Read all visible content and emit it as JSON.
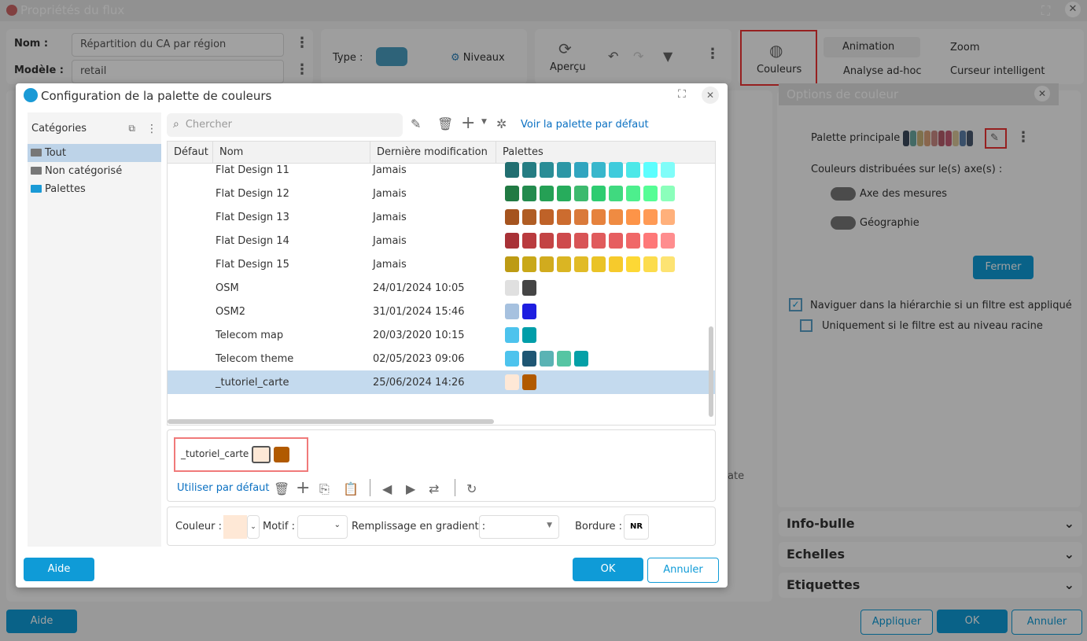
{
  "window": {
    "title": "Propriétés du flux"
  },
  "props": {
    "nom_label": "Nom :",
    "nom_value": "Répartition du CA par région",
    "modele_label": "Modèle :",
    "modele_value": "retail",
    "type_label": "Type :",
    "niveaux": "Niveaux",
    "apercu": "Aperçu",
    "couleurs": "Couleurs",
    "animation": "Animation",
    "zoom": "Zoom",
    "analyse": "Analyse ad-hoc",
    "curseur": "Curseur intelligent",
    "partial_label": "ate"
  },
  "color_options": {
    "title": "Options de couleur",
    "palette_label": "Palette principale :",
    "palette_colors": [
      "#3b4a5c",
      "#6aa9a0",
      "#c9b47a",
      "#d9a27a",
      "#c98a84",
      "#b55c6a",
      "#c35d74",
      "#d9c79a",
      "#5d7fa8",
      "#4a5a70"
    ],
    "axes_label": "Couleurs distribuées sur le(s) axe(s) :",
    "toggle_mesures": "Axe des mesures",
    "toggle_geo": "Géographie",
    "fermer": "Fermer"
  },
  "checks": {
    "naviguer": "Naviguer dans la hiérarchie si un filtre est appliqué",
    "naviguer_checked": true,
    "racine": "Uniquement si le filtre est au niveau racine",
    "racine_checked": false
  },
  "sections": [
    "Info-bulle",
    "Echelles",
    "Etiquettes"
  ],
  "footer": {
    "aide": "Aide",
    "appliquer": "Appliquer",
    "ok": "OK",
    "annuler": "Annuler"
  },
  "dialog": {
    "title": "Configuration de la palette de couleurs",
    "categories_header": "Catégories",
    "categories": [
      {
        "label": "Tout",
        "selected": true
      },
      {
        "label": "Non catégorisé"
      },
      {
        "label": "Palettes"
      }
    ],
    "search_placeholder": "Chercher",
    "voir_defaut": "Voir la palette par défaut",
    "columns": [
      "Défaut",
      "Nom",
      "Dernière modification",
      "Palettes"
    ],
    "rows": [
      {
        "name": "Flat Design 11",
        "modified": "Jamais",
        "colors": [
          "#216e70",
          "#257d83",
          "#2a8d96",
          "#2d97a6",
          "#31a5bf",
          "#38b7cc",
          "#3fcbdc",
          "#4de8e8",
          "#5cfefe",
          "#80fdf9"
        ]
      },
      {
        "name": "Flat Design 12",
        "modified": "Jamais",
        "colors": [
          "#217a43",
          "#238b4e",
          "#25a055",
          "#27ac5c",
          "#3dba6e",
          "#2ecc71",
          "#40d97f",
          "#4def8d",
          "#55fd95",
          "#8bffbb"
        ]
      },
      {
        "name": "Flat Design 13",
        "modified": "Jamais",
        "colors": [
          "#a5541f",
          "#b05d24",
          "#bf6228",
          "#cc6c2f",
          "#da7a3a",
          "#e6823d",
          "#ef8b42",
          "#fd9448",
          "#ff9a55",
          "#ffb07b"
        ]
      },
      {
        "name": "Flat Design 14",
        "modified": "Jamais",
        "colors": [
          "#a83237",
          "#b93b3e",
          "#c34444",
          "#ce4a4c",
          "#d85456",
          "#e05b5c",
          "#e65e60",
          "#f06868",
          "#fe7878",
          "#ff8d8e"
        ]
      },
      {
        "name": "Flat Design 15",
        "modified": "Jamais",
        "colors": [
          "#bd9b14",
          "#c9a819",
          "#d1ab1e",
          "#dab523",
          "#e1bb27",
          "#eac326",
          "#f6ca2c",
          "#fdd835",
          "#fcdc4d",
          "#fde372"
        ]
      },
      {
        "name": "OSM",
        "modified": "24/01/2024 10:05",
        "colors": [
          "#e0e0e0",
          "#454545"
        ]
      },
      {
        "name": "OSM2",
        "modified": "31/01/2024 15:46",
        "colors": [
          "#a6c1df",
          "#1e1ee0"
        ]
      },
      {
        "name": "Telecom map",
        "modified": "20/03/2020 10:15",
        "colors": [
          "#4dc3ed",
          "#009ea9"
        ]
      },
      {
        "name": "Telecom theme",
        "modified": "02/05/2023 09:06",
        "colors": [
          "#4dc3ed",
          "#1f5673",
          "#5ab3b4",
          "#56c5a3",
          "#04a0a7"
        ]
      },
      {
        "name": "_tutoriel_carte",
        "modified": "25/06/2024 14:26",
        "colors": [
          "#fee8d6",
          "#b15a00"
        ],
        "selected": true
      }
    ],
    "editor": {
      "name": "_tutoriel_carte",
      "colors": [
        "#fee8d6",
        "#b15a00"
      ],
      "utiliser_defaut": "Utiliser par défaut"
    },
    "props": {
      "couleur_label": "Couleur :",
      "couleur_value": "#fee8d6",
      "motif_label": "Motif :",
      "gradient_label": "Remplissage en gradient :",
      "bordure_label": "Bordure :",
      "bordure_value": "NR"
    },
    "aide": "Aide",
    "ok": "OK",
    "annuler": "Annuler"
  }
}
